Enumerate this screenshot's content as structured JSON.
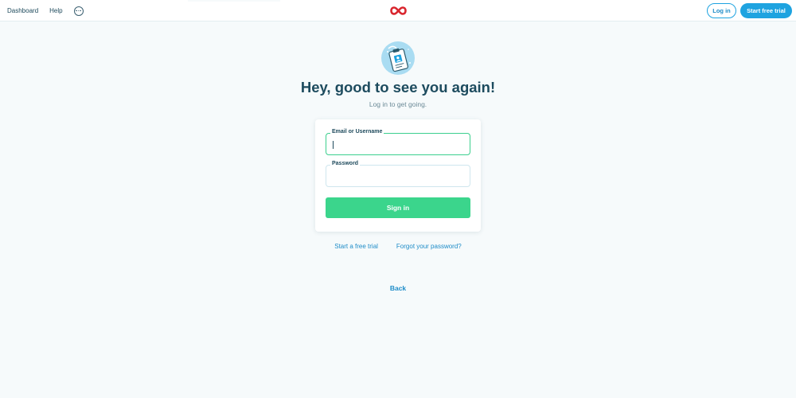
{
  "header": {
    "nav": {
      "dashboard_label": "Dashboard",
      "help_label": "Help",
      "more_icon": "more-horizontal-icon"
    },
    "logo_icon": "infinity-logo-icon",
    "login_label": "Log in",
    "trial_label": "Start free trial"
  },
  "main": {
    "hero_icon": "id-badge-icon",
    "title": "Hey, good to see you again!",
    "subtitle": "Log in to get going.",
    "form": {
      "email_label": "Email or Username",
      "email_value": "",
      "password_label": "Password",
      "password_value": "",
      "submit_label": "Sign in"
    },
    "links": {
      "free_trial": "Start a free trial",
      "forgot_password": "Forgot your password?"
    },
    "back_label": "Back"
  },
  "colors": {
    "background": "#f6fafb",
    "primary_blue": "#1ea3e0",
    "signin_green": "#3bd58c",
    "focus_green": "#3ccf8e",
    "heading": "#1d4b5e",
    "logo_red": "#d9262e"
  }
}
